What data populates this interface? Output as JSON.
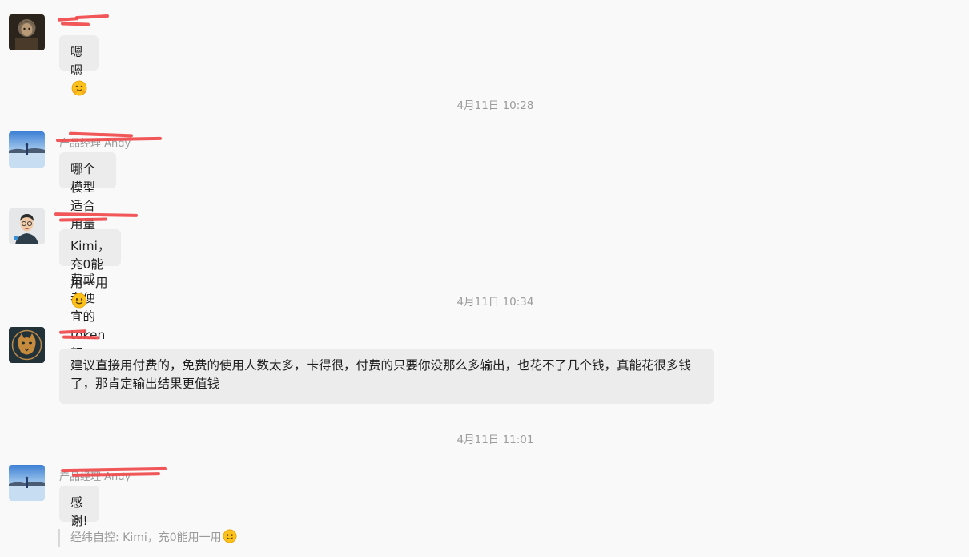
{
  "messages": [
    {
      "sender": "——",
      "text": "嗯嗯",
      "emoji": "hugging-face-emoji"
    },
    {
      "timestamp": "4月11日 10:28",
      "sender": "产品经理 Andy",
      "text": "哪个模型适合用量少的有免费或者便宜的token额度？"
    },
    {
      "sender": "经纬自控",
      "text": "Kimi，充0能用一用",
      "emoji": "smile-emoji"
    },
    {
      "timestamp": "4月11日 10:34",
      "sender": "——",
      "text": "建议直接用付费的，免费的使用人数太多，卡得很，付费的只要你没那么多输出，也花不了几个钱，真能花很多钱了，那肯定输出结果更值钱"
    },
    {
      "timestamp": "4月11日 11:01",
      "sender": "产品经理 Andy",
      "text": "感谢!",
      "quote": "经纬自控: Kimi，充0能用一用",
      "quote_emoji": "smile-emoji"
    }
  ],
  "colors": {
    "background": "#f9f9f9",
    "bubble": "#ececec",
    "redaction": "#f0484a",
    "timestamp": "#9c9c9c"
  }
}
